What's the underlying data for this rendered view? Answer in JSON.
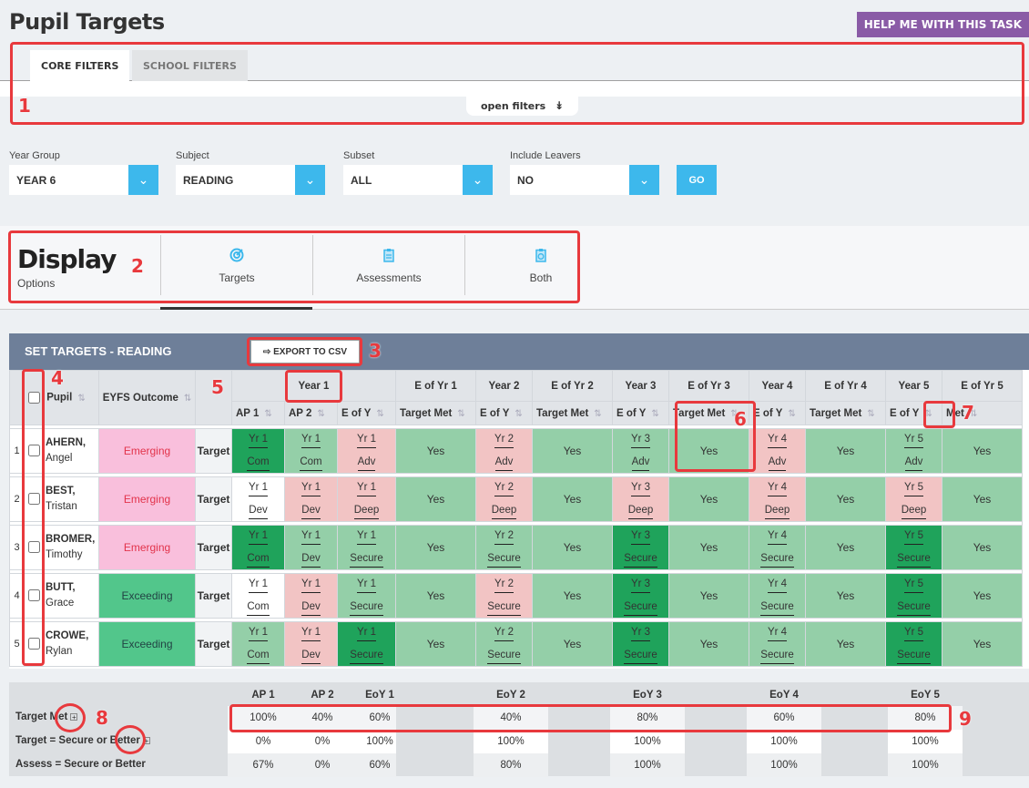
{
  "page": {
    "title": "Pupil Targets",
    "help_button": "HELP ME WITH THIS TASK"
  },
  "filter_tabs": [
    {
      "label": "CORE FILTERS",
      "active": true
    },
    {
      "label": "SCHOOL FILTERS",
      "active": false
    }
  ],
  "open_filters": {
    "label": "open filters",
    "icon": "double-chevron-down-icon"
  },
  "selects": [
    {
      "label": "Year Group",
      "value": "YEAR 6"
    },
    {
      "label": "Subject",
      "value": "READING"
    },
    {
      "label": "Subset",
      "value": "ALL"
    },
    {
      "label": "Include Leavers",
      "value": "NO"
    }
  ],
  "go_button": "GO",
  "display": {
    "title": "Display",
    "subtitle": "Options",
    "options": [
      {
        "label": "Targets",
        "icon": "target-icon",
        "selected": true
      },
      {
        "label": "Assessments",
        "icon": "clipboard-icon",
        "selected": false
      },
      {
        "label": "Both",
        "icon": "clipboard-target-icon",
        "selected": false
      }
    ]
  },
  "table": {
    "title": "SET TARGETS - READING",
    "export_button": "EXPORT TO CSV",
    "headers": {
      "pupil": "Pupil",
      "eyfs": "EYFS Outcome"
    },
    "group_headers": [
      "Year 1",
      "E of Yr 1",
      "Year 2",
      "E of Yr 2",
      "Year 3",
      "E of Yr 3",
      "Year 4",
      "E of Yr 4",
      "Year 5",
      "E of Yr 5"
    ],
    "sub_headers": [
      "AP 1",
      "AP 2",
      "E of Y",
      "Target Met",
      "E of Y",
      "Target Met",
      "E of Y",
      "Target Met",
      "E of Y",
      "Target Met",
      "E of Y",
      "Met"
    ],
    "row_label": "Target",
    "rows": [
      {
        "num": "1",
        "surname": "AHERN,",
        "first": "Angel",
        "eyfs": "Emerging",
        "eyfs_type": "em",
        "cells": [
          {
            "y": "Yr 1",
            "g": "Com",
            "c": "dark"
          },
          {
            "y": "Yr 1",
            "g": "Com",
            "c": "light"
          },
          {
            "y": "Yr 1",
            "g": "Adv",
            "c": "pink"
          },
          {
            "t": "Yes"
          },
          {
            "y": "Yr 2",
            "g": "Adv",
            "c": "pink"
          },
          {
            "t": "Yes"
          },
          {
            "y": "Yr 3",
            "g": "Adv",
            "c": "light"
          },
          {
            "t": "Yes"
          },
          {
            "y": "Yr 4",
            "g": "Adv",
            "c": "pink"
          },
          {
            "t": "Yes"
          },
          {
            "y": "Yr 5",
            "g": "Adv",
            "c": "light"
          },
          {
            "t": "Yes"
          }
        ]
      },
      {
        "num": "2",
        "surname": "BEST,",
        "first": "Tristan",
        "eyfs": "Emerging",
        "eyfs_type": "em",
        "cells": [
          {
            "y": "Yr 1",
            "g": "Dev",
            "c": "white"
          },
          {
            "y": "Yr 1",
            "g": "Dev",
            "c": "pink"
          },
          {
            "y": "Yr 1",
            "g": "Deep",
            "c": "pink"
          },
          {
            "t": "Yes"
          },
          {
            "y": "Yr 2",
            "g": "Deep",
            "c": "pink"
          },
          {
            "t": "Yes"
          },
          {
            "y": "Yr 3",
            "g": "Deep",
            "c": "pink"
          },
          {
            "t": "Yes"
          },
          {
            "y": "Yr 4",
            "g": "Deep",
            "c": "pink"
          },
          {
            "t": "Yes"
          },
          {
            "y": "Yr 5",
            "g": "Deep",
            "c": "pink"
          },
          {
            "t": "Yes"
          }
        ]
      },
      {
        "num": "3",
        "surname": "BROMER,",
        "first": "Timothy",
        "eyfs": "Emerging",
        "eyfs_type": "em",
        "cells": [
          {
            "y": "Yr 1",
            "g": "Com",
            "c": "dark"
          },
          {
            "y": "Yr 1",
            "g": "Dev",
            "c": "light"
          },
          {
            "y": "Yr 1",
            "g": "Secure",
            "c": "light"
          },
          {
            "t": "Yes"
          },
          {
            "y": "Yr 2",
            "g": "Secure",
            "c": "light"
          },
          {
            "t": "Yes"
          },
          {
            "y": "Yr 3",
            "g": "Secure",
            "c": "dark"
          },
          {
            "t": "Yes"
          },
          {
            "y": "Yr 4",
            "g": "Secure",
            "c": "light"
          },
          {
            "t": "Yes"
          },
          {
            "y": "Yr 5",
            "g": "Secure",
            "c": "dark"
          },
          {
            "t": "Yes"
          }
        ]
      },
      {
        "num": "4",
        "surname": "BUTT,",
        "first": "Grace",
        "eyfs": "Exceeding",
        "eyfs_type": "ex",
        "cells": [
          {
            "y": "Yr 1",
            "g": "Com",
            "c": "white"
          },
          {
            "y": "Yr 1",
            "g": "Dev",
            "c": "pink"
          },
          {
            "y": "Yr 1",
            "g": "Secure",
            "c": "light"
          },
          {
            "t": "Yes"
          },
          {
            "y": "Yr 2",
            "g": "Secure",
            "c": "pink"
          },
          {
            "t": "Yes"
          },
          {
            "y": "Yr 3",
            "g": "Secure",
            "c": "dark"
          },
          {
            "t": "Yes"
          },
          {
            "y": "Yr 4",
            "g": "Secure",
            "c": "light"
          },
          {
            "t": "Yes"
          },
          {
            "y": "Yr 5",
            "g": "Secure",
            "c": "dark"
          },
          {
            "t": "Yes"
          }
        ]
      },
      {
        "num": "5",
        "surname": "CROWE,",
        "first": "Rylan",
        "eyfs": "Exceeding",
        "eyfs_type": "ex",
        "cells": [
          {
            "y": "Yr 1",
            "g": "Com",
            "c": "light"
          },
          {
            "y": "Yr 1",
            "g": "Dev",
            "c": "pink"
          },
          {
            "y": "Yr 1",
            "g": "Secure",
            "c": "dark"
          },
          {
            "t": "Yes"
          },
          {
            "y": "Yr 2",
            "g": "Secure",
            "c": "light"
          },
          {
            "t": "Yes"
          },
          {
            "y": "Yr 3",
            "g": "Secure",
            "c": "dark"
          },
          {
            "t": "Yes"
          },
          {
            "y": "Yr 4",
            "g": "Secure",
            "c": "light"
          },
          {
            "t": "Yes"
          },
          {
            "y": "Yr 5",
            "g": "Secure",
            "c": "dark"
          },
          {
            "t": "Yes"
          }
        ]
      }
    ]
  },
  "summary": {
    "columns": [
      "AP 1",
      "AP 2",
      "EoY 1",
      "EoY 2",
      "EoY 3",
      "EoY 4",
      "EoY 5"
    ],
    "rows": [
      {
        "label": "Target Met",
        "expand_icon": true,
        "values": [
          "100%",
          "40%",
          "60%",
          "40%",
          "80%",
          "60%",
          "80%"
        ]
      },
      {
        "label": "Target = Secure or Better",
        "expand_icon": true,
        "values": [
          "0%",
          "0%",
          "100%",
          "100%",
          "100%",
          "100%",
          "100%"
        ]
      },
      {
        "label": "Assess = Secure or Better",
        "expand_icon": false,
        "values": [
          "67%",
          "0%",
          "60%",
          "80%",
          "100%",
          "100%",
          "100%"
        ]
      }
    ]
  },
  "annotations": [
    "1",
    "2",
    "3",
    "4",
    "5",
    "6",
    "7",
    "8",
    "9"
  ],
  "colors": {
    "accent": "#3db8ec",
    "help": "#8a5ba6",
    "table_header": "#6e7f99",
    "annotation": "#e8393d",
    "dark_green": "#1fa35b",
    "light_green": "#94cfa8",
    "pink": "#f2c4c4",
    "eyfs_emerging": "#f9bfdc",
    "eyfs_exceeding": "#52c68b"
  }
}
